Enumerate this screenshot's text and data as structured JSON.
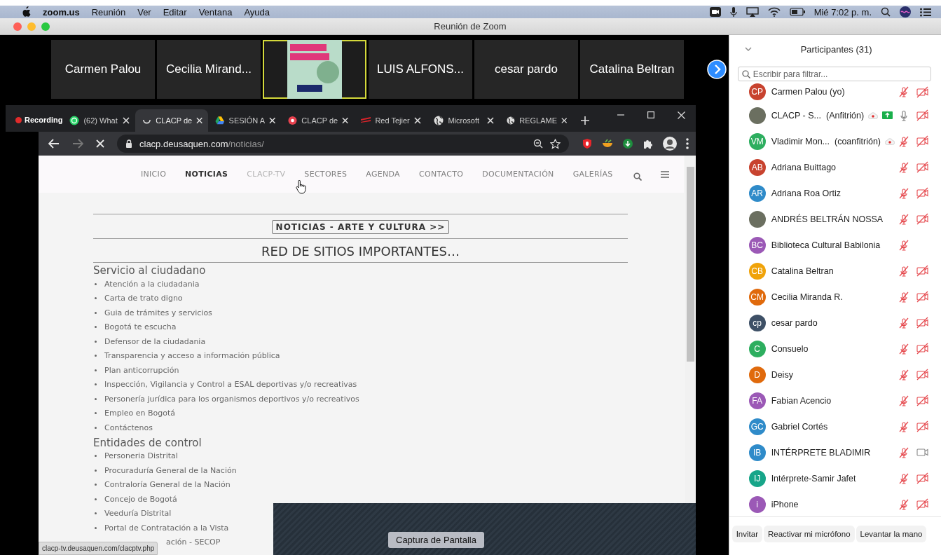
{
  "menu_bar": {
    "app": "zoom.us",
    "items": [
      "Reunión",
      "Ver",
      "Editar",
      "Ventana",
      "Ayuda"
    ],
    "clock": "Mié 7:02 p. m."
  },
  "window": {
    "title": "Reunión de Zoom"
  },
  "video_strip": {
    "tiles": [
      {
        "kind": "name",
        "label": "Carmen Palou",
        "speaking": false
      },
      {
        "kind": "name",
        "label": "Cecilia Mirand...",
        "speaking": false
      },
      {
        "kind": "poster",
        "speaking": true
      },
      {
        "kind": "name",
        "label": "LUIS ALFONS...",
        "speaking": false
      },
      {
        "kind": "name",
        "label": "cesar pardo",
        "speaking": false
      },
      {
        "kind": "name",
        "label": "Catalina Beltran",
        "speaking": false
      }
    ]
  },
  "shared_screen": {
    "recording_label": "Recording",
    "tabs": [
      {
        "kind": "chat",
        "title": "(62) What",
        "selected": false
      },
      {
        "kind": "loading",
        "title": "CLACP de",
        "selected": true
      },
      {
        "kind": "drive",
        "title": "SESIÓN A",
        "selected": false
      },
      {
        "kind": "record",
        "title": "CLACP de",
        "selected": false
      },
      {
        "kind": "stripes",
        "title": "Red Tejier",
        "selected": false
      },
      {
        "kind": "globe",
        "title": "Microsoft",
        "selected": false
      },
      {
        "kind": "globe",
        "title": "REGLAME",
        "selected": false
      }
    ],
    "address": {
      "host": "clacp.deusaquen.com",
      "path": "/noticias/"
    },
    "nav": [
      {
        "label": "INICIO",
        "selected": false,
        "hovered": false
      },
      {
        "label": "NOTICIAS",
        "selected": true,
        "hovered": false
      },
      {
        "label": "CLACP-TV",
        "selected": false,
        "hovered": true
      },
      {
        "label": "SECTORES",
        "selected": false,
        "hovered": false
      },
      {
        "label": "AGENDA",
        "selected": false,
        "hovered": false
      },
      {
        "label": "CONTACTO",
        "selected": false,
        "hovered": false
      },
      {
        "label": "DOCUMENTACIÓN",
        "selected": false,
        "hovered": false
      },
      {
        "label": "GALERÍAS",
        "selected": false,
        "hovered": false
      }
    ],
    "news_button": "NOTICIAS - ARTE Y CULTURA >>",
    "heading": "RED DE SITIOS IMPORTANTES…",
    "sections": [
      {
        "title": "Servicio al ciudadano",
        "items": [
          {
            "text": "Atención a la ciudadania",
            "covered": false
          },
          {
            "text": "Carta de trato digno",
            "covered": false
          },
          {
            "text": "Guia de trámites y servicios",
            "covered": false
          },
          {
            "text": "Bogotá te escucha",
            "covered": false
          },
          {
            "text": "Defensor de la ciudadania",
            "covered": false
          },
          {
            "text": "Transparencia y acceso a información pública",
            "covered": false
          },
          {
            "text": "Plan anticorrupción",
            "covered": false
          },
          {
            "text": "Inspección, Vigilancia y Control a ESAL deportivas y/o recreativas",
            "covered": false
          },
          {
            "text": "Personería jurídica para los organismos deportivos y/o recreativos",
            "covered": false
          },
          {
            "text": "Empleo en Bogotá",
            "covered": false
          },
          {
            "text": "Contáctenos",
            "covered": false
          }
        ]
      },
      {
        "title": "Entidades de control",
        "items": [
          {
            "text": "Personeria Distrital",
            "covered": false
          },
          {
            "text": "Procuraduría General de la Nación",
            "covered": false
          },
          {
            "text": "Contraloría General de la Nación",
            "covered": false
          },
          {
            "text": "Concejo de Bogotá",
            "covered": false
          },
          {
            "text": "Veeduría Distrital",
            "covered": false
          },
          {
            "text": "Portal de Contratación a la Vista",
            "covered": false
          },
          {
            "text": "ación - SECOP",
            "covered": true
          }
        ]
      }
    ],
    "status_link": "clacp-tv.deusaquen.com/clacptv.php",
    "tooltip": "Captura de Pantalla"
  },
  "participants": {
    "title": "Participantes (31)",
    "search": {
      "placeholder": "Escribir para filtrar..."
    },
    "list": [
      {
        "kind": "initials",
        "initials": "CP",
        "color": "#c8432f",
        "name": "Carmen Palou (yo)",
        "mic_muted": true,
        "video_off": true
      },
      {
        "kind": "photo",
        "name": "CLACP - S...",
        "role": "(Anfitrión)",
        "recording": true,
        "sharing": true,
        "mic_muted": false,
        "video_off": true
      },
      {
        "kind": "initials",
        "initials": "VM",
        "color": "#2dae5f",
        "name": "Vladimir Mon...",
        "role": "(coanfitrión)",
        "recording": true,
        "sharing": false,
        "mic_muted": true,
        "video_off": true
      },
      {
        "kind": "initials",
        "initials": "AB",
        "color": "#c8432f",
        "name": "Adriana Buittago",
        "mic_muted": true,
        "video_off": true
      },
      {
        "kind": "initials",
        "initials": "AR",
        "color": "#2f8bc9",
        "name": "Adriana Roa Ortiz",
        "mic_muted": true,
        "video_off": true
      },
      {
        "kind": "photo",
        "name": "ANDRÉS BELTRÁN NOSSA",
        "mic_muted": true,
        "video_off": true
      },
      {
        "kind": "initials",
        "initials": "BC",
        "color": "#9b59b6",
        "name": "Biblioteca Cultural Babilonia",
        "mic_muted": true
      },
      {
        "kind": "initials",
        "initials": "CB",
        "color": "#f0a30a",
        "name": "Catalina Beltran",
        "mic_muted": true,
        "video_off": true
      },
      {
        "kind": "initials",
        "initials": "CM",
        "color": "#e06a0c",
        "name": "Cecilia Miranda R.",
        "mic_muted": true,
        "video_off": true
      },
      {
        "kind": "initials",
        "initials": "cp",
        "color": "#3e5066",
        "name": "cesar pardo",
        "mic_muted": true,
        "video_off": true
      },
      {
        "kind": "initials",
        "initials": "C",
        "color": "#2dae5f",
        "name": "Consuelo",
        "mic_muted": true,
        "video_off": true
      },
      {
        "kind": "initials",
        "initials": "D",
        "color": "#e06a0c",
        "name": "Deisy",
        "mic_muted": true,
        "video_off": true
      },
      {
        "kind": "initials",
        "initials": "FA",
        "color": "#9b59b6",
        "name": "Fabian Acencio",
        "mic_muted": true,
        "video_off": true
      },
      {
        "kind": "initials",
        "initials": "GC",
        "color": "#2f8bc9",
        "name": "Gabriel Cortés",
        "mic_muted": true,
        "video_off": true
      },
      {
        "kind": "initials",
        "initials": "IB",
        "color": "#2f8bc9",
        "name": "INTÉRPRETE BLADIMIR",
        "mic_muted": true,
        "video_off": false
      },
      {
        "kind": "initials",
        "initials": "IJ",
        "color": "#17a589",
        "name": "Intérprete-Samir Jafet",
        "mic_muted": true,
        "video_off": true
      },
      {
        "kind": "initials",
        "initials": "i",
        "color": "#9b59b6",
        "name": "iPhone",
        "mic_muted": true,
        "video_off": true
      }
    ],
    "buttons": [
      "Invitar",
      "Reactivar mi micrófono",
      "Levantar la mano"
    ]
  }
}
